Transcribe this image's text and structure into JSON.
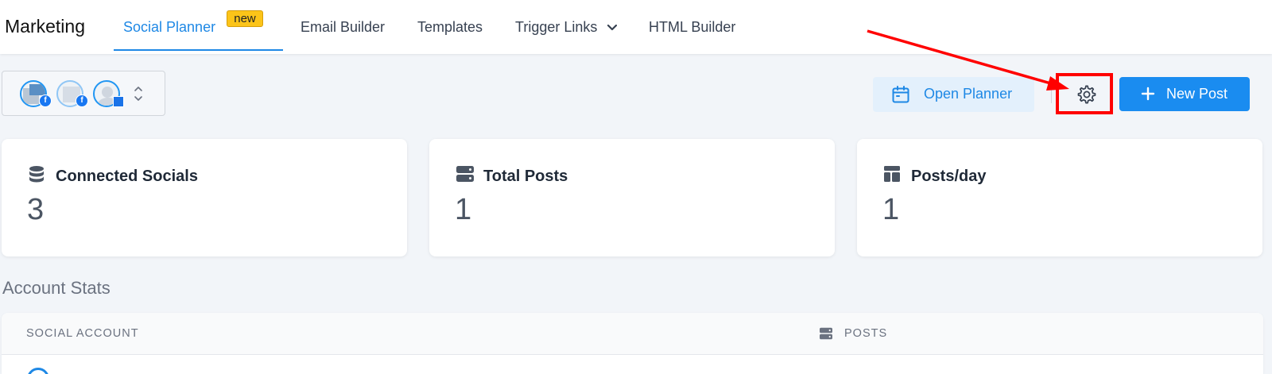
{
  "topnav": {
    "brand": "Marketing",
    "items": [
      {
        "label": "Social Planner",
        "active": true
      },
      {
        "label": "Email Builder"
      },
      {
        "label": "Templates"
      },
      {
        "label": "Trigger Links",
        "has_dropdown": true
      },
      {
        "label": "HTML Builder"
      }
    ],
    "badge": "new"
  },
  "accounts": {
    "avatars": [
      {
        "network": "facebook",
        "badge": "f"
      },
      {
        "network": "facebook",
        "badge": "f"
      },
      {
        "network": "google-my-business",
        "badge": ""
      }
    ]
  },
  "toolbar": {
    "open_planner_label": "Open Planner",
    "new_post_label": "New Post"
  },
  "stats": [
    {
      "title": "Connected Socials",
      "value": "3",
      "icon": "database-icon"
    },
    {
      "title": "Total Posts",
      "value": "1",
      "icon": "server-icon"
    },
    {
      "title": "Posts/day",
      "value": "1",
      "icon": "layout-icon"
    }
  ],
  "account_stats": {
    "title": "Account Stats",
    "columns": [
      "SOCIAL ACCOUNT",
      "POSTS"
    ]
  },
  "colors": {
    "accent": "#1e88e5",
    "primary_button": "#1a8cf0",
    "badge": "#fcc419",
    "annotation": "#ff0000"
  }
}
